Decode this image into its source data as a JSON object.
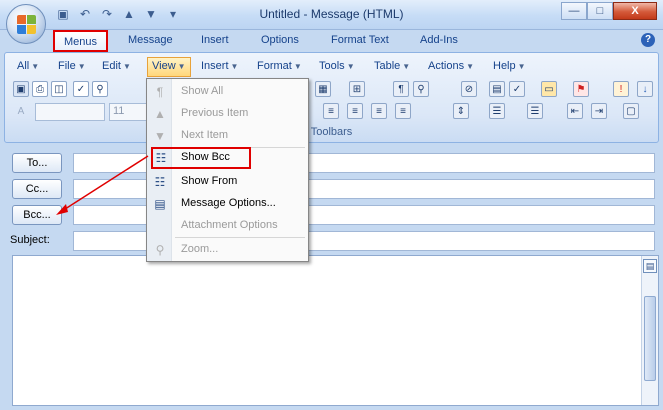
{
  "window": {
    "title": "Untitled - Message (HTML)",
    "minimize_glyph": "—",
    "maximize_glyph": "□",
    "close_glyph": "X"
  },
  "quick_access": [
    "save-icon",
    "undo-icon",
    "redo-icon",
    "up-icon",
    "down-icon",
    "customize-icon"
  ],
  "ribbon_tabs": [
    "Menus",
    "Message",
    "Insert",
    "Options",
    "Format Text",
    "Add-Ins"
  ],
  "active_tab": "Menus",
  "help_glyph": "?",
  "menubar": {
    "items": [
      "All",
      "File",
      "Edit",
      "View",
      "Insert",
      "Format",
      "Tools",
      "Table",
      "Actions",
      "Help"
    ],
    "active": "View"
  },
  "toolbar": {
    "font_combo": "",
    "size_combo": "11",
    "group_label": "Toolbars"
  },
  "view_menu": {
    "items": [
      {
        "label": "Show All",
        "icon": "paragraph-icon",
        "enabled": false
      },
      {
        "label": "Previous Item",
        "icon": "up-arrow-icon",
        "enabled": false
      },
      {
        "label": "Next Item",
        "icon": "down-arrow-icon",
        "enabled": false
      },
      {
        "label": "Show Bcc",
        "icon": "show-bcc-icon",
        "enabled": true,
        "highlighted": true
      },
      {
        "label": "Show From",
        "icon": "show-from-icon",
        "enabled": true
      },
      {
        "label": "Message Options...",
        "icon": "message-options-icon",
        "enabled": true
      },
      {
        "label": "Attachment Options",
        "icon": "none",
        "enabled": false
      },
      {
        "label": "Zoom...",
        "icon": "zoom-icon",
        "enabled": false
      }
    ]
  },
  "address": {
    "to_label": "To...",
    "cc_label": "Cc...",
    "bcc_label": "Bcc...",
    "subject_label": "Subject:",
    "to_value": "",
    "cc_value": "",
    "bcc_value": "",
    "subject_value": ""
  },
  "colors": {
    "highlight_red": "#e00000",
    "ribbon_blue": "#c5d9f1",
    "text_blue": "#15428b"
  }
}
